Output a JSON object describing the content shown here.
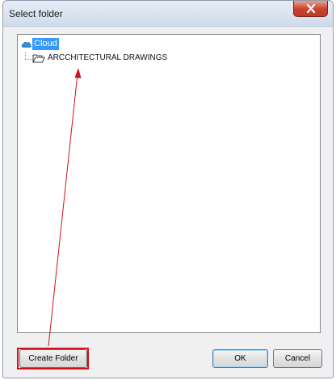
{
  "window": {
    "title": "Select folder"
  },
  "tree": {
    "root": {
      "label": "Cloud",
      "icon": "cloud-icon"
    },
    "children": [
      {
        "label": "ARCCHITECTURAL DRAWINGS",
        "icon": "folder-open-icon"
      }
    ]
  },
  "buttons": {
    "create_folder": "Create Folder",
    "ok": "OK",
    "cancel": "Cancel"
  },
  "colors": {
    "annotation": "#d0121a",
    "selection": "#3399ff",
    "close_button": "#c7412e"
  }
}
